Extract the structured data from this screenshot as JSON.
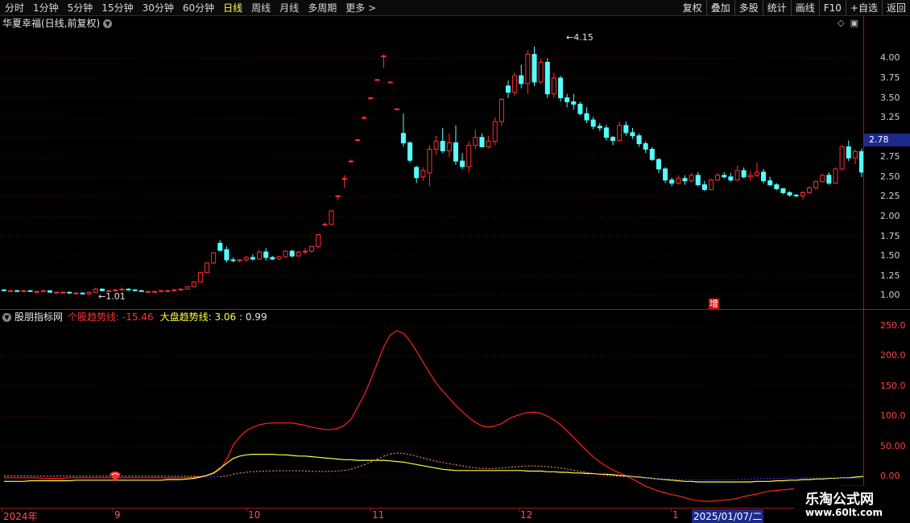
{
  "toolbar": {
    "periods": [
      "分时",
      "1分钟",
      "5分钟",
      "15分钟",
      "30分钟",
      "60分钟",
      "日线",
      "周线",
      "月线",
      "多周期",
      "更多 >"
    ],
    "active_index": 6,
    "right_buttons": [
      "复权",
      "叠加",
      "多股",
      "统计",
      "画线",
      "F10",
      "+自选",
      "返回"
    ]
  },
  "stock": {
    "title": "华夏幸福(日线,前复权)",
    "current_price": "2.78",
    "high_label": "4.15",
    "low_label": "1.01",
    "marker": "增"
  },
  "indicator": {
    "source": "股朋指标网",
    "line1_label": "个股趋势线:",
    "line1_value": "-15.46",
    "line2_label": "大盘趋势线:",
    "line2_value": "3.06",
    "line3_value": ": 0.99"
  },
  "price_axis": [
    "4.00",
    "3.75",
    "3.50",
    "3.25",
    "3.00",
    "2.75",
    "2.50",
    "2.25",
    "2.00",
    "1.75",
    "1.50",
    "1.25",
    "1.00"
  ],
  "indicator_axis": [
    "250.0",
    "200.0",
    "150.0",
    "100.0",
    "50.00",
    "0.00"
  ],
  "date_axis": {
    "labels": [
      "2024年",
      "9",
      "10",
      "11",
      "12",
      "1"
    ],
    "selected": "2025/01/07/二"
  },
  "watermark": {
    "line1": "乐淘公式网",
    "line2": "www.60lt.com"
  },
  "colors": {
    "up": "#ff3030",
    "down": "#54ffff",
    "background": "#000000",
    "axis": "#a01818"
  },
  "chart_data": {
    "type": "candlestick",
    "ylim": [
      0.9,
      4.3
    ],
    "candles": [
      [
        1.07,
        1.08,
        1.05,
        1.06
      ],
      [
        1.06,
        1.07,
        1.04,
        1.06
      ],
      [
        1.06,
        1.07,
        1.05,
        1.05
      ],
      [
        1.05,
        1.07,
        1.04,
        1.06
      ],
      [
        1.06,
        1.07,
        1.05,
        1.05
      ],
      [
        1.05,
        1.06,
        1.04,
        1.05
      ],
      [
        1.05,
        1.07,
        1.04,
        1.06
      ],
      [
        1.06,
        1.06,
        1.04,
        1.04
      ],
      [
        1.04,
        1.05,
        1.03,
        1.04
      ],
      [
        1.04,
        1.05,
        1.03,
        1.04
      ],
      [
        1.04,
        1.05,
        1.02,
        1.03
      ],
      [
        1.03,
        1.04,
        1.02,
        1.03
      ],
      [
        1.03,
        1.04,
        1.01,
        1.02
      ],
      [
        1.02,
        1.05,
        1.01,
        1.04
      ],
      [
        1.04,
        1.1,
        1.03,
        1.08
      ],
      [
        1.08,
        1.09,
        1.05,
        1.06
      ],
      [
        1.06,
        1.07,
        1.05,
        1.06
      ],
      [
        1.06,
        1.08,
        1.05,
        1.07
      ],
      [
        1.07,
        1.1,
        1.06,
        1.08
      ],
      [
        1.08,
        1.09,
        1.06,
        1.07
      ],
      [
        1.07,
        1.08,
        1.05,
        1.06
      ],
      [
        1.06,
        1.07,
        1.05,
        1.05
      ],
      [
        1.05,
        1.06,
        1.04,
        1.05
      ],
      [
        1.05,
        1.06,
        1.04,
        1.05
      ],
      [
        1.05,
        1.07,
        1.04,
        1.06
      ],
      [
        1.06,
        1.07,
        1.05,
        1.06
      ],
      [
        1.06,
        1.08,
        1.05,
        1.07
      ],
      [
        1.07,
        1.09,
        1.06,
        1.08
      ],
      [
        1.08,
        1.12,
        1.07,
        1.11
      ],
      [
        1.11,
        1.18,
        1.1,
        1.17
      ],
      [
        1.17,
        1.3,
        1.16,
        1.29
      ],
      [
        1.29,
        1.42,
        1.28,
        1.41
      ],
      [
        1.41,
        1.55,
        1.4,
        1.54
      ],
      [
        1.66,
        1.7,
        1.56,
        1.57
      ],
      [
        1.58,
        1.62,
        1.42,
        1.45
      ],
      [
        1.45,
        1.48,
        1.42,
        1.44
      ],
      [
        1.44,
        1.46,
        1.42,
        1.45
      ],
      [
        1.45,
        1.5,
        1.43,
        1.48
      ],
      [
        1.48,
        1.52,
        1.44,
        1.46
      ],
      [
        1.46,
        1.57,
        1.45,
        1.55
      ],
      [
        1.55,
        1.6,
        1.44,
        1.48
      ],
      [
        1.48,
        1.5,
        1.45,
        1.46
      ],
      [
        1.46,
        1.5,
        1.45,
        1.49
      ],
      [
        1.49,
        1.57,
        1.47,
        1.56
      ],
      [
        1.56,
        1.58,
        1.48,
        1.5
      ],
      [
        1.5,
        1.56,
        1.49,
        1.55
      ],
      [
        1.55,
        1.6,
        1.52,
        1.56
      ],
      [
        1.56,
        1.63,
        1.54,
        1.62
      ],
      [
        1.62,
        1.78,
        1.6,
        1.77
      ],
      [
        1.9,
        1.92,
        1.88,
        1.9
      ],
      [
        1.9,
        2.08,
        1.89,
        2.07
      ],
      [
        2.25,
        2.27,
        2.2,
        2.26
      ],
      [
        2.47,
        2.52,
        2.36,
        2.48
      ],
      [
        2.7,
        2.72,
        2.68,
        2.7
      ],
      [
        2.97,
        2.98,
        2.95,
        2.97
      ],
      [
        3.25,
        3.27,
        3.23,
        3.25
      ],
      [
        3.5,
        3.51,
        3.49,
        3.5
      ],
      [
        3.73,
        3.74,
        3.72,
        3.73
      ],
      [
        4.02,
        4.05,
        3.88,
        4.03
      ],
      [
        3.7,
        3.71,
        3.69,
        3.7
      ],
      [
        3.36,
        3.37,
        3.35,
        3.36
      ],
      [
        3.05,
        3.3,
        2.88,
        2.93
      ],
      [
        2.93,
        2.95,
        2.68,
        2.71
      ],
      [
        2.62,
        2.64,
        2.42,
        2.49
      ],
      [
        2.5,
        2.62,
        2.45,
        2.58
      ],
      [
        2.55,
        2.9,
        2.38,
        2.85
      ],
      [
        2.85,
        3.02,
        2.78,
        2.95
      ],
      [
        2.95,
        3.12,
        2.8,
        2.83
      ],
      [
        2.83,
        3.05,
        2.75,
        2.93
      ],
      [
        2.93,
        3.15,
        2.65,
        2.7
      ],
      [
        2.7,
        2.8,
        2.6,
        2.63
      ],
      [
        2.63,
        2.95,
        2.55,
        2.9
      ],
      [
        2.9,
        3.1,
        2.85,
        3.0
      ],
      [
        3.0,
        3.05,
        2.88,
        2.88
      ],
      [
        2.88,
        3.02,
        2.86,
        2.95
      ],
      [
        2.95,
        3.25,
        2.9,
        3.2
      ],
      [
        3.2,
        3.5,
        3.15,
        3.48
      ],
      [
        3.65,
        3.72,
        3.5,
        3.57
      ],
      [
        3.57,
        3.82,
        3.52,
        3.78
      ],
      [
        3.78,
        3.92,
        3.62,
        3.68
      ],
      [
        3.68,
        4.1,
        3.55,
        4.05
      ],
      [
        4.05,
        4.15,
        3.65,
        3.7
      ],
      [
        3.7,
        4.0,
        3.68,
        3.95
      ],
      [
        3.95,
        4.0,
        3.5,
        3.55
      ],
      [
        3.55,
        3.82,
        3.5,
        3.75
      ],
      [
        3.75,
        3.78,
        3.45,
        3.5
      ],
      [
        3.5,
        3.55,
        3.38,
        3.45
      ],
      [
        3.45,
        3.55,
        3.35,
        3.42
      ],
      [
        3.42,
        3.45,
        3.28,
        3.3
      ],
      [
        3.3,
        3.38,
        3.18,
        3.22
      ],
      [
        3.22,
        3.26,
        3.1,
        3.14
      ],
      [
        3.14,
        3.18,
        3.08,
        3.12
      ],
      [
        3.12,
        3.16,
        2.96,
        3.0
      ],
      [
        3.0,
        3.02,
        2.9,
        2.96
      ],
      [
        2.96,
        3.2,
        2.95,
        3.15
      ],
      [
        3.15,
        3.2,
        3.02,
        3.06
      ],
      [
        3.06,
        3.12,
        2.98,
        3.02
      ],
      [
        3.02,
        3.05,
        2.88,
        2.92
      ],
      [
        2.92,
        2.95,
        2.8,
        2.85
      ],
      [
        2.85,
        2.88,
        2.7,
        2.72
      ],
      [
        2.72,
        2.74,
        2.55,
        2.6
      ],
      [
        2.6,
        2.62,
        2.42,
        2.46
      ],
      [
        2.46,
        2.49,
        2.38,
        2.42
      ],
      [
        2.42,
        2.52,
        2.4,
        2.48
      ],
      [
        2.48,
        2.52,
        2.4,
        2.45
      ],
      [
        2.45,
        2.55,
        2.43,
        2.52
      ],
      [
        2.52,
        2.56,
        2.38,
        2.4
      ],
      [
        2.4,
        2.45,
        2.32,
        2.34
      ],
      [
        2.34,
        2.48,
        2.33,
        2.46
      ],
      [
        2.46,
        2.55,
        2.45,
        2.52
      ],
      [
        2.52,
        2.56,
        2.48,
        2.5
      ],
      [
        2.5,
        2.55,
        2.44,
        2.46
      ],
      [
        2.46,
        2.64,
        2.45,
        2.58
      ],
      [
        2.58,
        2.62,
        2.48,
        2.5
      ],
      [
        2.5,
        2.58,
        2.45,
        2.52
      ],
      [
        2.52,
        2.68,
        2.5,
        2.56
      ],
      [
        2.56,
        2.6,
        2.42,
        2.45
      ],
      [
        2.45,
        2.5,
        2.38,
        2.4
      ],
      [
        2.4,
        2.42,
        2.33,
        2.35
      ],
      [
        2.35,
        2.36,
        2.28,
        2.3
      ],
      [
        2.3,
        2.32,
        2.25,
        2.27
      ],
      [
        2.27,
        2.28,
        2.24,
        2.26
      ],
      [
        2.26,
        2.32,
        2.22,
        2.3
      ],
      [
        2.3,
        2.38,
        2.28,
        2.36
      ],
      [
        2.36,
        2.46,
        2.34,
        2.44
      ],
      [
        2.44,
        2.54,
        2.43,
        2.52
      ],
      [
        2.52,
        2.56,
        2.4,
        2.42
      ],
      [
        2.42,
        2.62,
        2.41,
        2.6
      ],
      [
        2.6,
        2.9,
        2.58,
        2.88
      ],
      [
        2.88,
        2.96,
        2.7,
        2.74
      ],
      [
        2.74,
        2.85,
        2.66,
        2.82
      ],
      [
        2.82,
        2.86,
        2.5,
        2.56
      ]
    ],
    "indicator_ylim": [
      -45,
      270
    ],
    "series": [
      {
        "name": "个股趋势线",
        "values": [
          -2,
          -2,
          -2,
          -2,
          -2,
          -2,
          -3,
          -3,
          -3,
          -3,
          -2,
          -2,
          -2,
          -2,
          -2,
          -2,
          -2,
          -2,
          -2,
          -2,
          -2,
          -2,
          -2,
          -2,
          -2,
          -2,
          -2,
          -2,
          -2,
          -1,
          0,
          2,
          5,
          12,
          28,
          52,
          66,
          76,
          82,
          86,
          88,
          89,
          89,
          89,
          89,
          87,
          85,
          82,
          80,
          78,
          78,
          80,
          85,
          95,
          115,
          135,
          160,
          188,
          215,
          235,
          242,
          238,
          225,
          208,
          190,
          172,
          155,
          142,
          130,
          118,
          108,
          98,
          90,
          84,
          82,
          84,
          88,
          95,
          100,
          104,
          106,
          107,
          105,
          100,
          94,
          86,
          76,
          65,
          54,
          43,
          33,
          24,
          17,
          11,
          6,
          1,
          -4,
          -10,
          -16,
          -20,
          -24,
          -27,
          -30,
          -32,
          -35,
          -38,
          -40,
          -41,
          -41,
          -40,
          -39,
          -38,
          -36,
          -33,
          -31,
          -29,
          -26,
          -24,
          -23,
          -22,
          -21,
          -20,
          -19,
          -18,
          -18,
          -17,
          -17,
          -17,
          -16,
          -16,
          -16,
          -16,
          -16,
          -15,
          -15,
          -15
        ]
      },
      {
        "name": "大盘趋势线",
        "values": [
          -8,
          -8,
          -8,
          -8,
          -7,
          -7,
          -7,
          -7,
          -7,
          -7,
          -7,
          -6,
          -6,
          -6,
          -6,
          -6,
          -6,
          -6,
          -6,
          -6,
          -6,
          -6,
          -6,
          -6,
          -6,
          -5,
          -5,
          -5,
          -4,
          -3,
          -1,
          2,
          6,
          14,
          22,
          30,
          34,
          36,
          37,
          37,
          37,
          37,
          36,
          36,
          35,
          34,
          34,
          33,
          32,
          31,
          30,
          29,
          28,
          28,
          27,
          27,
          27,
          27,
          27,
          26,
          25,
          24,
          22,
          20,
          18,
          16,
          14,
          12,
          11,
          10,
          10,
          10,
          10,
          10,
          10,
          10,
          10,
          10,
          10,
          10,
          9,
          9,
          9,
          8,
          8,
          7,
          7,
          6,
          6,
          5,
          5,
          4,
          4,
          3,
          2,
          1,
          0,
          -1,
          -2,
          -3,
          -4,
          -5,
          -6,
          -7,
          -8,
          -8,
          -9,
          -9,
          -9,
          -9,
          -9,
          -9,
          -9,
          -9,
          -9,
          -8,
          -8,
          -8,
          -7,
          -7,
          -6,
          -6,
          -5,
          -5,
          -4,
          -4,
          -3,
          -3,
          -2,
          -2,
          -1,
          0,
          1,
          2,
          2,
          3,
          3
        ]
      }
    ]
  }
}
